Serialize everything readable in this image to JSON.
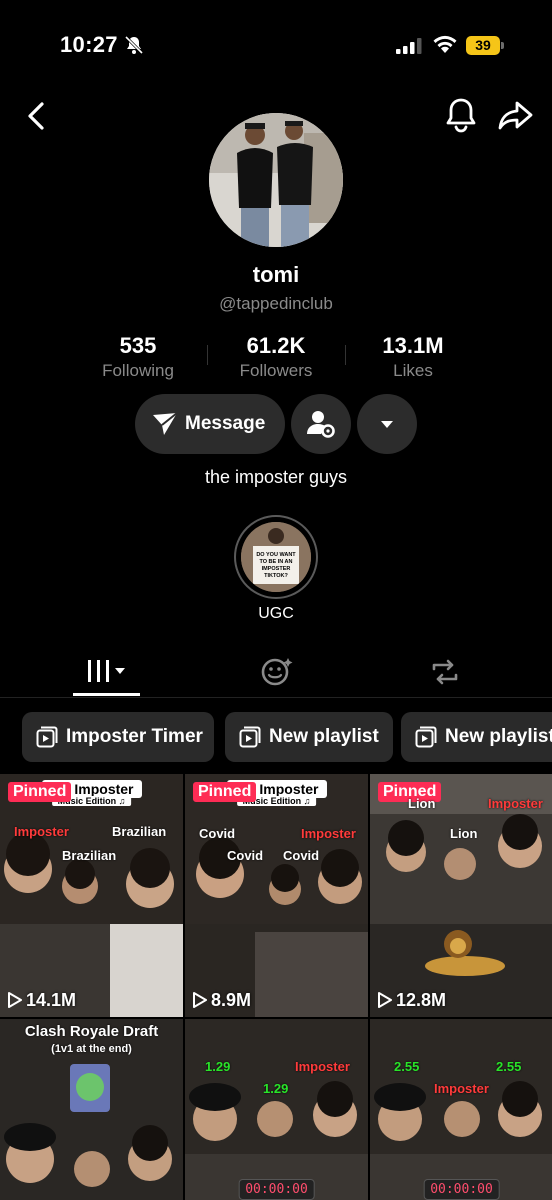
{
  "status_bar": {
    "time": "10:27",
    "battery": "39"
  },
  "profile": {
    "display_name": "tomi",
    "username": "@tappedinclub",
    "bio": "the imposter guys"
  },
  "stats": [
    {
      "value": "535",
      "label": "Following"
    },
    {
      "value": "61.2K",
      "label": "Followers"
    },
    {
      "value": "13.1M",
      "label": "Likes"
    }
  ],
  "actions": {
    "message_label": "Message"
  },
  "highlight": {
    "label": "UGC",
    "sign_text": "DO YOU WANT TO BE IN AN IMPOSTER TIKTOK?"
  },
  "playlists": [
    {
      "label": "Imposter Timer"
    },
    {
      "label": "New playlist"
    },
    {
      "label": "New playlist"
    }
  ],
  "videos": [
    {
      "pinned": "Pinned",
      "views": "14.1M",
      "banner": "the Imposter",
      "banner_sub": "Music Edition ♫",
      "tags": [
        "Imposter",
        "Brazilian",
        "Brazilian"
      ]
    },
    {
      "pinned": "Pinned",
      "views": "8.9M",
      "banner": "the Imposter",
      "banner_sub": "Music Edition ♫",
      "tags": [
        "Covid",
        "Imposter",
        "Covid",
        "Covid"
      ]
    },
    {
      "pinned": "Pinned",
      "views": "12.8M",
      "tags": [
        "Lion",
        "Imposter",
        "Lion"
      ]
    },
    {
      "title": "Clash Royale Draft",
      "subtitle": "(1v1 at the end)"
    },
    {
      "tags": [
        "1.29",
        "Imposter",
        "1.29"
      ],
      "timer": "00:00:00"
    },
    {
      "tags": [
        "2.55",
        "2.55",
        "Imposter"
      ],
      "timer": "00:00:00"
    }
  ],
  "colors": {
    "accent": "#fe2c55",
    "button_bg": "#2c2c2c",
    "secondary_text": "#8a8a8a"
  }
}
